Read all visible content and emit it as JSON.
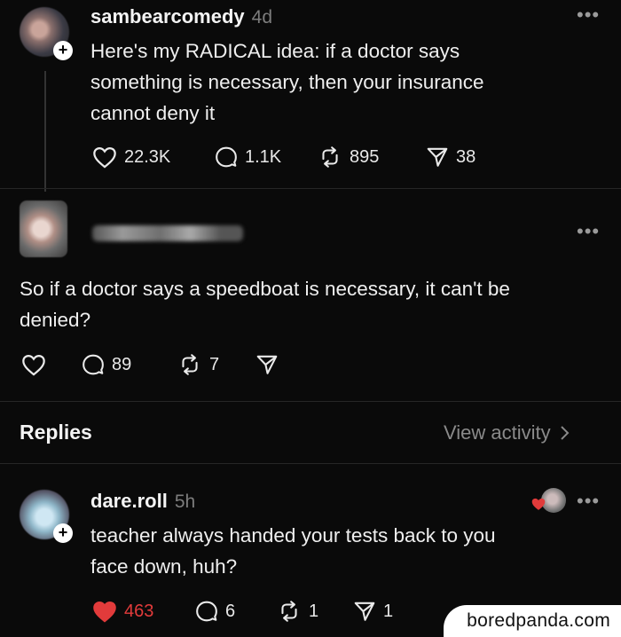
{
  "post": {
    "username": "sambearcomedy",
    "time": "4d",
    "text_lines": [
      "Here's my RADICAL idea: if a doctor says",
      "something is necessary, then your  insurance",
      "cannot deny it"
    ],
    "likes": "22.3K",
    "comments": "1.1K",
    "reposts": "895",
    "shares": "38",
    "more_icon": "ellipsis-icon"
  },
  "reply": {
    "username": "",
    "text_lines": [
      "So if a doctor says a speedboat is necessary, it can't be",
      "denied?"
    ],
    "likes": "",
    "comments": "89",
    "reposts": "7",
    "shares": ""
  },
  "replies_section": {
    "title": "Replies",
    "view_activity": "View activity"
  },
  "comment": {
    "username": "dare.roll",
    "time": "5h",
    "text_lines": [
      "teacher always handed your tests back to you",
      "face down, huh?"
    ],
    "likes": "463",
    "comments": "6",
    "reposts": "1",
    "shares": "1"
  },
  "watermark": "boredpanda.com",
  "colors": {
    "background": "#0a0a0a",
    "text": "#f2f2f2",
    "muted": "#7d7d7d",
    "liked_red": "#e23b3b"
  }
}
